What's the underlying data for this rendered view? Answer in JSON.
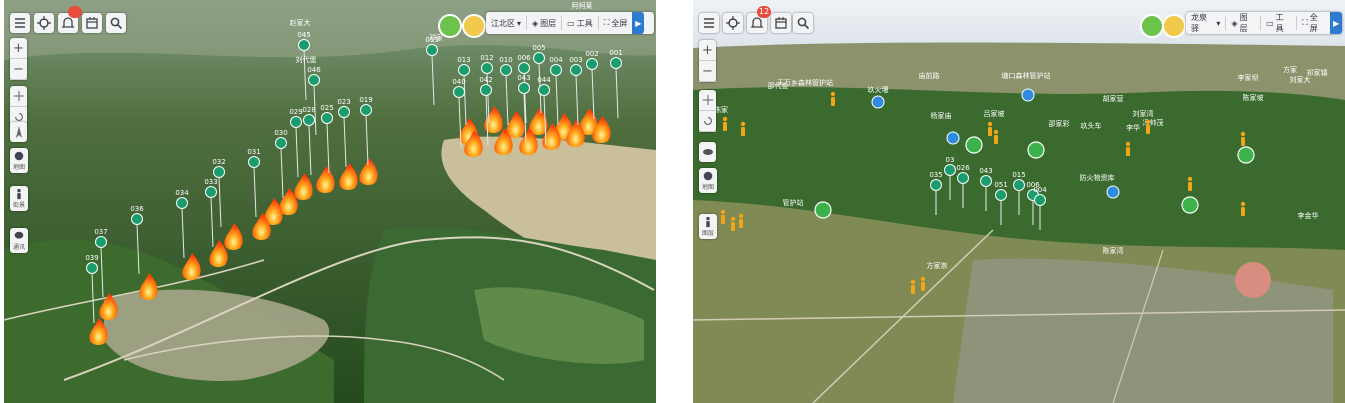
{
  "left": {
    "notification_count": "",
    "toolbar": {
      "region": "江北区",
      "basemap": "图层",
      "tools": "工具",
      "fullscreen": "全屏"
    },
    "side_labels": {
      "map": "地图",
      "person": "街景",
      "chat": "通讯"
    },
    "place_labels": [
      "赵家大",
      "刘代堡",
      "邓家",
      "阿柯莱"
    ],
    "towers": [
      "001",
      "002",
      "003",
      "004",
      "005",
      "006",
      "010",
      "012",
      "013",
      "015",
      "019",
      "023",
      "025",
      "028",
      "029",
      "030",
      "031",
      "032",
      "033",
      "034",
      "036",
      "037",
      "039",
      "040",
      "042",
      "043",
      "044",
      "045",
      "046"
    ],
    "colors": {
      "tower": "#1a9d6c",
      "fire": "#ff5a12",
      "accent": "#2b7bd1"
    }
  },
  "right": {
    "notification_count": "12",
    "toolbar": {
      "region": "龙泉驿",
      "basemap": "图层",
      "tools": "工具",
      "fullscreen": "全屏"
    },
    "side_labels": {
      "map": "地图",
      "person": "图层"
    },
    "place_labels": [
      "邵代金",
      "天万乡森林管护站",
      "玖火堰",
      "庙前路",
      "塘口森林管护站",
      "邵家彩",
      "玖头车",
      "李家坝",
      "刘家大",
      "陈家坡",
      "胡家营",
      "刘家湾",
      "防火物资库",
      "管护站",
      "杨家庙",
      "吕家坡",
      "李华",
      "冯帅茂",
      "方家崇",
      "陈家湾",
      "陈家",
      "李金华",
      "方家",
      "祁家镇"
    ],
    "towers": [
      "035",
      "043",
      "026",
      "051",
      "006",
      "015",
      "004",
      "03"
    ],
    "colors": {
      "tower": "#1a9d6c",
      "person": "#f2a516",
      "shelter": "#2e8be0"
    }
  }
}
